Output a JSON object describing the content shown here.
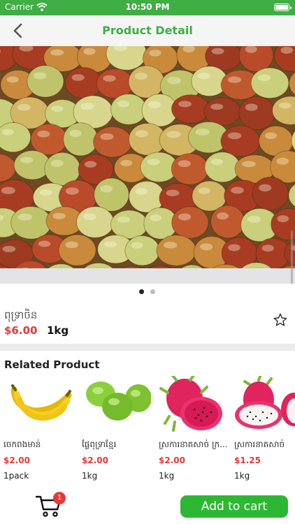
{
  "status_bar": {
    "carrier": "Carrier",
    "time": "10:50 PM"
  },
  "nav": {
    "title": "Product Detail",
    "back_icon": "chevron-left-icon"
  },
  "pager": {
    "count": 2,
    "active": 1
  },
  "product": {
    "name": "ពុទ្រាចិន",
    "price": "$6.00",
    "unit": "1kg",
    "favorite_icon": "star-outline-icon"
  },
  "related": {
    "title": "Related Product",
    "items": [
      {
        "name": "ចេកពងមាន់",
        "price": "$2.00",
        "unit": "1pack",
        "icon": "banana-icon"
      },
      {
        "name": "ផ្លែពុទ្រាខ្មែរ",
        "price": "$2.00",
        "unit": "1kg",
        "icon": "jujube-icon"
      },
      {
        "name": "ស្រការនាគសាច់ ក្រ...",
        "price": "$2.00",
        "unit": "1kg",
        "icon": "dragon-fruit-icon"
      },
      {
        "name": "ស្រការនាគសាច់",
        "price": "$1.25",
        "unit": "1kg",
        "icon": "dragon-fruit-icon"
      }
    ]
  },
  "bottom": {
    "cart_count": "1",
    "add_to_cart": "Add to cart",
    "cart_icon": "cart-icon"
  },
  "colors": {
    "brand": "#3fae44",
    "price": "#e53935",
    "button": "#2db833"
  }
}
